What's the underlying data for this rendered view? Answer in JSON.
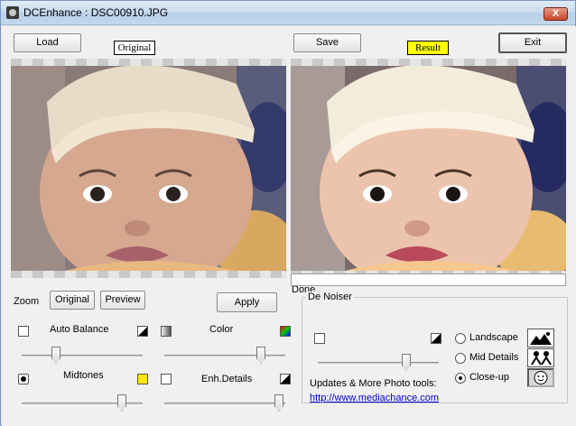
{
  "window": {
    "title": "DCEnhance : DSC00910.JPG",
    "close_label": "X"
  },
  "toolbar": {
    "load_label": "Load",
    "save_label": "Save",
    "exit_label": "Exit"
  },
  "tags": {
    "original": "Original",
    "result": "Result",
    "result_color": "#ffff00"
  },
  "zoom": {
    "label": "Zoom",
    "original_label": "Original",
    "preview_label": "Preview",
    "apply_label": "Apply"
  },
  "status": {
    "text": "Done...",
    "progress": 0
  },
  "sliders": {
    "auto_balance": {
      "label": "Auto Balance",
      "value": 0.22
    },
    "color": {
      "label": "Color",
      "value": 0.85
    },
    "midtones": {
      "label": "Midtones",
      "value": 0.85
    },
    "enh_details": {
      "label": "Enh.Details",
      "value": 0.98
    }
  },
  "denoiser": {
    "title": "De Noiser",
    "slider_value": 0.7,
    "modes": [
      {
        "label": "Landscape",
        "selected": false,
        "icon": "landscape-icon"
      },
      {
        "label": "Mid Details",
        "selected": false,
        "icon": "people-icon"
      },
      {
        "label": "Close-up",
        "selected": true,
        "icon": "face-icon"
      }
    ],
    "updates_text": "Updates & More Photo tools:",
    "link_text": "http://www.mediachance.com"
  }
}
